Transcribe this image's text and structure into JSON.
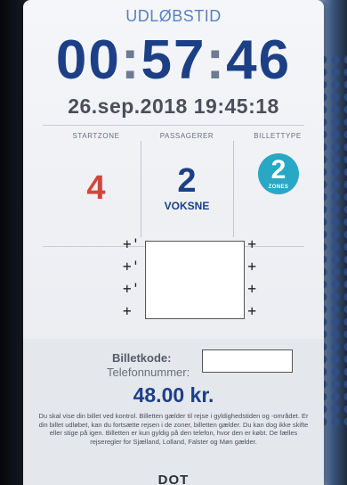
{
  "ticket": {
    "header_label": "UDLØBSTID",
    "countdown": {
      "hours": "00",
      "minutes": "57",
      "seconds": "46",
      "separator": ":"
    },
    "expiry_datetime": "26.sep.2018 19:45:18",
    "columns": {
      "zone": {
        "header": "STARTZONE",
        "value": "4"
      },
      "passengers": {
        "header": "PASSAGERER",
        "value": "2",
        "sub": "VOKSNE"
      },
      "type": {
        "header": "BILLETTYPE",
        "value": "2",
        "sub": "ZONES"
      }
    },
    "code_lines": [
      {
        "left": "+'",
        "right": "+"
      },
      {
        "left": "+'",
        "right": "+"
      },
      {
        "left": "+'",
        "right": "+"
      },
      {
        "left": "+",
        "right": "+"
      }
    ],
    "ticket_code_label": "Billetkode:",
    "phone_label": "Telefonnummer:",
    "price": "48.00 kr.",
    "disclaimer": "Du skal vise din billet ved kontrol. Billetten gælder til rejse i gyldighedstiden og -området. Er din billet udløbet, kan du fortsætte rejsen i de zoner, billetten gælder. Du kan dog ikke skifte eller stige på igen. Billetten er kun gyldig på den telefon, hvor den er købt. De fælles rejseregler for Sjælland, Lolland, Falster og Møn gælder.",
    "logo": "DOT"
  },
  "colors": {
    "brand_blue": "#1d3f86",
    "zone_red": "#d2463a",
    "type_teal": "#28a8c4"
  }
}
